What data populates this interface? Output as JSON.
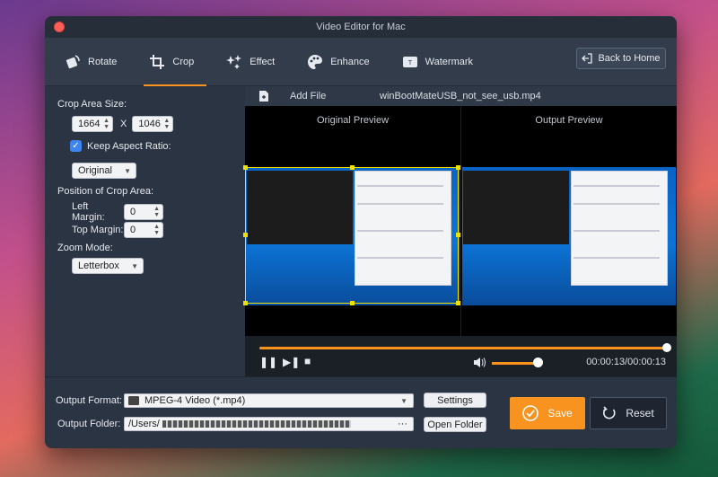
{
  "window": {
    "title": "Video Editor for Mac"
  },
  "toolbar": {
    "tools": [
      {
        "label": "Rotate",
        "icon": "rotate-icon"
      },
      {
        "label": "Crop",
        "icon": "crop-icon",
        "active": true
      },
      {
        "label": "Effect",
        "icon": "sparkle-icon"
      },
      {
        "label": "Enhance",
        "icon": "palette-icon"
      },
      {
        "label": "Watermark",
        "icon": "watermark-icon"
      }
    ],
    "back_home_label": "Back to Home"
  },
  "crop": {
    "area_size_label": "Crop Area Size:",
    "width": "1664",
    "x_label": "X",
    "height": "1046",
    "keep_aspect_label": "Keep Aspect Ratio:",
    "keep_aspect_checked": true,
    "aspect_value": "Original",
    "position_label": "Position of Crop Area:",
    "left_margin_label": "Left Margin:",
    "left_margin": "0",
    "top_margin_label": "Top Margin:",
    "top_margin": "0",
    "zoom_label": "Zoom Mode:",
    "zoom_value": "Letterbox"
  },
  "preview": {
    "add_file_label": "Add File",
    "filename": "winBootMateUSB_not_see_usb.mp4",
    "original_caption": "Original Preview",
    "output_caption": "Output Preview",
    "progress": 1.0,
    "volume": 0.85,
    "time": "00:00:13/00:00:13"
  },
  "output": {
    "format_label": "Output Format:",
    "format_value": "MPEG-4 Video (*.mp4)",
    "settings_label": "Settings",
    "folder_label": "Output Folder:",
    "folder_value": "/Users/",
    "folder_more": "···",
    "open_folder_label": "Open Folder",
    "save_label": "Save",
    "reset_label": "Reset"
  },
  "colors": {
    "accent": "#f7931e",
    "crop_frame": "#f0e200",
    "panel": "#2b3442"
  }
}
